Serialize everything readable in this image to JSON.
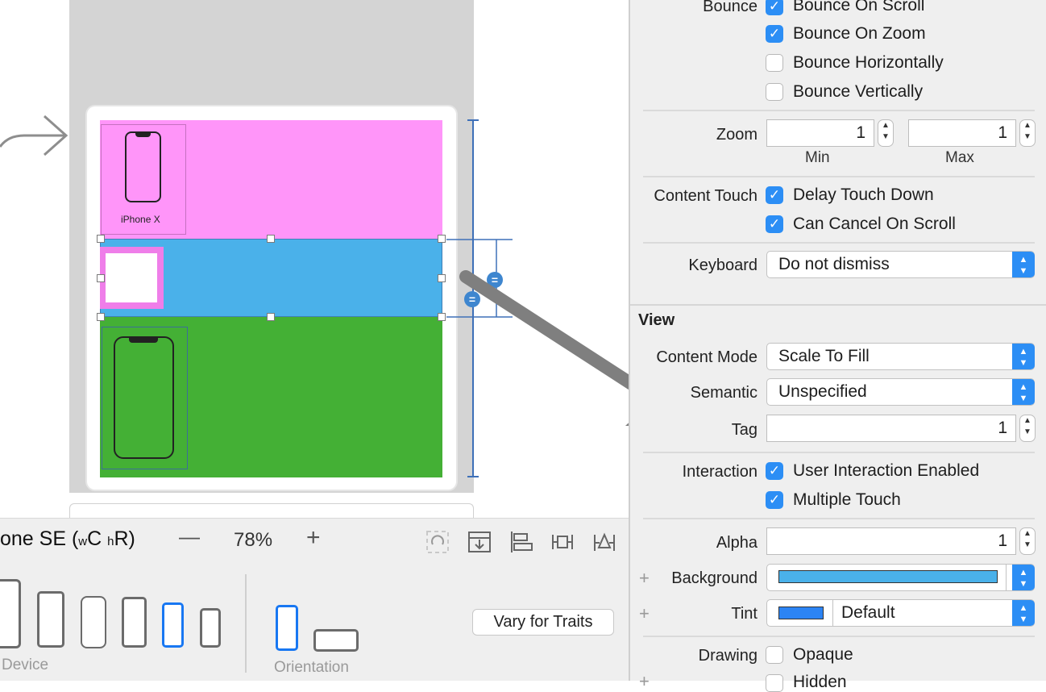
{
  "canvas": {
    "scene_phone_label": "iPhone X"
  },
  "bottom_bar": {
    "device_config": "one SE (",
    "width_class_w": "w",
    "width_class_v": "C",
    "height_class_h": "h",
    "height_class_v": "R",
    "device_config_end": ")",
    "zoom_out": "—",
    "zoom_level": "78%",
    "zoom_in": "+"
  },
  "device_panel": {
    "device_label": "Device",
    "orientation_label": "Orientation",
    "vary_button": "Vary for Traits"
  },
  "inspector": {
    "bounce_label": "Bounce",
    "bounce_on_scroll": "Bounce On Scroll",
    "bounce_on_zoom": "Bounce On Zoom",
    "bounce_horizontally": "Bounce Horizontally",
    "bounce_vertically": "Bounce Vertically",
    "zoom_label": "Zoom",
    "zoom_min_value": "1",
    "zoom_max_value": "1",
    "zoom_min_caption": "Min",
    "zoom_max_caption": "Max",
    "content_touch_label": "Content Touch",
    "delay_touch_down": "Delay Touch Down",
    "can_cancel_on_scroll": "Can Cancel On Scroll",
    "keyboard_label": "Keyboard",
    "keyboard_value": "Do not dismiss",
    "view_header": "View",
    "content_mode_label": "Content Mode",
    "content_mode_value": "Scale To Fill",
    "semantic_label": "Semantic",
    "semantic_value": "Unspecified",
    "tag_label": "Tag",
    "tag_value": "1",
    "interaction_label": "Interaction",
    "user_interaction_enabled": "User Interaction Enabled",
    "multiple_touch": "Multiple Touch",
    "alpha_label": "Alpha",
    "alpha_value": "1",
    "background_label": "Background",
    "background_color": "#4ab1ea",
    "tint_label": "Tint",
    "tint_color": "#2c84f4",
    "tint_value": "Default",
    "drawing_label": "Drawing",
    "opaque": "Opaque",
    "hidden": "Hidden"
  },
  "colors": {
    "accent": "#2c8ef5",
    "pink_view": "#ff95f9",
    "blue_view": "#4ab1ea",
    "green_view": "#44b035"
  }
}
